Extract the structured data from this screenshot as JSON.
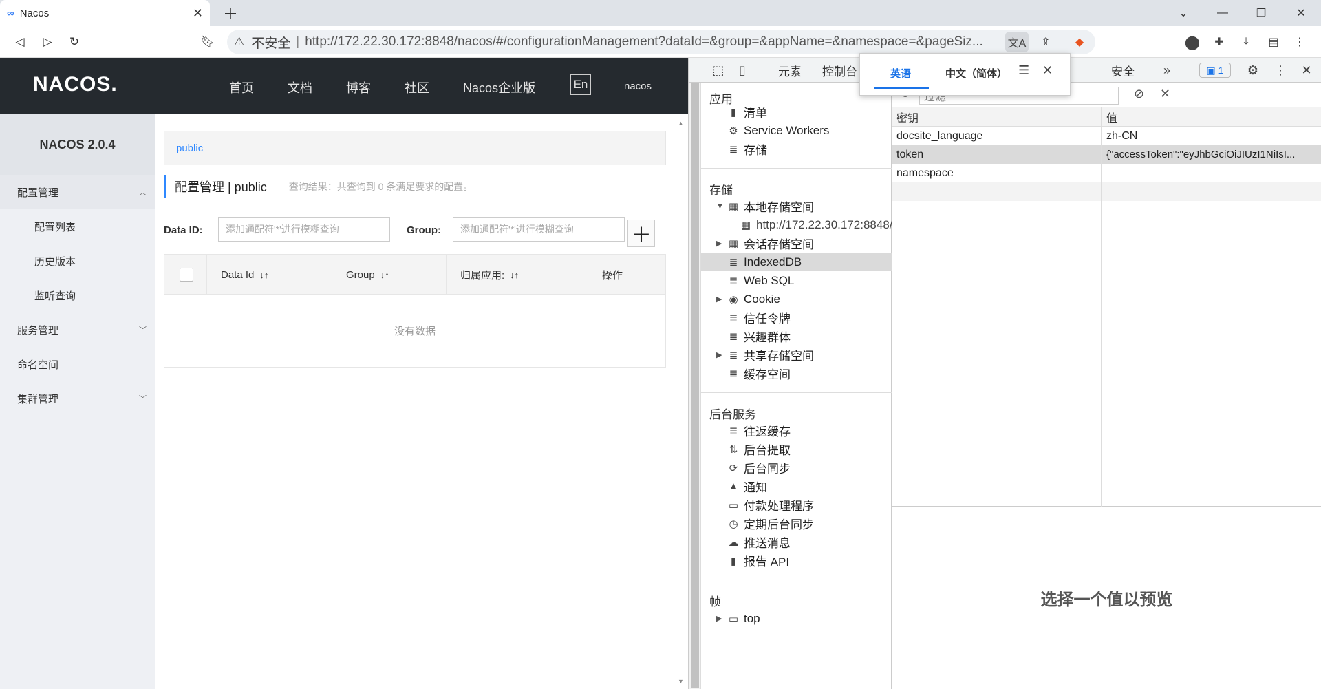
{
  "browser": {
    "tab_title": "Nacos",
    "tab_icon": "∞",
    "address_security": "不安全",
    "address_url": "http://172.22.30.172:8848/nacos/#/configurationManagement?dataId=&group=&appName=&namespace=&pageSiz..."
  },
  "nacos": {
    "logo": "NACOS.",
    "nav": [
      "首页",
      "文档",
      "博客",
      "社区",
      "Nacos企业版"
    ],
    "lang": "En",
    "user": "nacos",
    "version": "NACOS 2.0.4",
    "sidebar": [
      "配置管理",
      "配置列表",
      "历史版本",
      "监听查询",
      "服务管理",
      "命名空间",
      "集群管理"
    ],
    "breadcrumb": "public",
    "page_title": "配置管理 | public",
    "query_result": "查询结果：共查询到 0 条满足要求的配置。",
    "data_id_label": "Data ID:",
    "group_label": "Group:",
    "placeholder": "添加通配符'*'进行模糊查询",
    "columns": [
      "Data Id",
      "Group",
      "归属应用:",
      "操作"
    ],
    "empty": "没有数据"
  },
  "devtools": {
    "tabs": [
      "元素",
      "控制台",
      "安全"
    ],
    "issues_count": "1",
    "sections": {
      "app": "应用",
      "app_items": [
        "清单",
        "Service Workers",
        "存储"
      ],
      "storage": "存储",
      "storage_items": [
        "本地存储空间",
        "http://172.22.30.172:8848/",
        "会话存储空间",
        "IndexedDB",
        "Web SQL",
        "Cookie",
        "信任令牌",
        "兴趣群体",
        "共享存储空间",
        "缓存空间"
      ],
      "bg": "后台服务",
      "bg_items": [
        "往返缓存",
        "后台提取",
        "后台同步",
        "通知",
        "付款处理程序",
        "定期后台同步",
        "推送消息",
        "报告 API"
      ],
      "frames": "帧",
      "frames_items": [
        "top"
      ]
    },
    "filter_placeholder": "过滤",
    "kv_headers": [
      "密钥",
      "值"
    ],
    "kv_rows": [
      {
        "key": "docsite_language",
        "value": "zh-CN"
      },
      {
        "key": "token",
        "value": "{\"accessToken\":\"eyJhbGciOiJIUzI1NiIsI..."
      },
      {
        "key": "namespace",
        "value": ""
      }
    ],
    "preview_text": "选择一个值以预览"
  },
  "translate": {
    "tab1": "英语",
    "tab2": "中文（简体）"
  }
}
